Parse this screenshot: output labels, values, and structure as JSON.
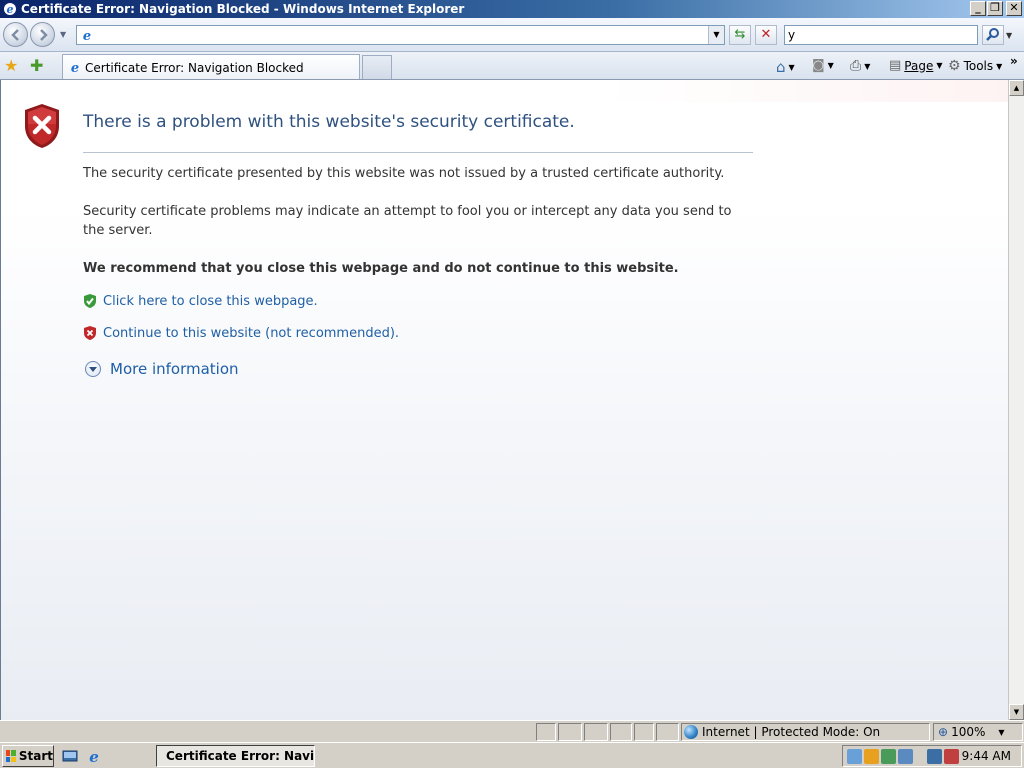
{
  "window": {
    "title": "Certificate Error: Navigation Blocked - Windows Internet Explorer",
    "min": "_",
    "max": "❐",
    "close": "✕"
  },
  "address_bar": {
    "value": "",
    "search_value": "y"
  },
  "tab": {
    "label": "Certificate Error: Navigation Blocked"
  },
  "commands": {
    "page": "Page",
    "tools": "Tools",
    "more": "»"
  },
  "content": {
    "headline": "There is a problem with this website's security certificate.",
    "p1": "The security certificate presented by this website was not issued by a trusted certificate authority.",
    "p2": "Security certificate problems may indicate an attempt to fool you or intercept any data you send to the server.",
    "recommend": "We recommend that you close this webpage and do not continue to this website.",
    "close_link": "Click here to close this webpage.",
    "continue_link": "Continue to this website (not recommended).",
    "more_info": "More information"
  },
  "status": {
    "zone": "Internet | Protected Mode: On",
    "zoom": "100%"
  },
  "taskbar": {
    "start": "Start",
    "task_label": "Certificate Error: Navi...",
    "clock": "9:44 AM"
  },
  "colors": {
    "headline": "#2f5180",
    "link": "#1f5fa6",
    "shield_red": "#c0282a",
    "shield_green": "#3a9a3a"
  }
}
